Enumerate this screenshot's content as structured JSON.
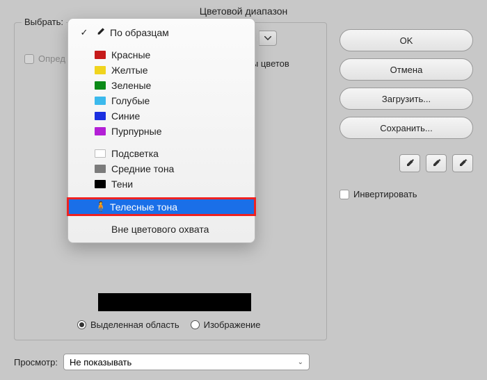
{
  "dialog": {
    "title": "Цветовой диапазон",
    "select_label": "Выбрать:",
    "detect_label": "Опред",
    "partial_text": "боры цветов"
  },
  "dropdown": {
    "sampled": "По образцам",
    "colors": [
      {
        "label": "Красные",
        "color": "#c61a1a"
      },
      {
        "label": "Желтые",
        "color": "#f0d41e"
      },
      {
        "label": "Зеленые",
        "color": "#0a8a17"
      },
      {
        "label": "Голубые",
        "color": "#3bb9ec"
      },
      {
        "label": "Синие",
        "color": "#1a2fe0"
      },
      {
        "label": "Пурпурные",
        "color": "#b31fd6"
      }
    ],
    "tones": [
      {
        "label": "Подсветка",
        "swatch": "#ffffff",
        "border": "#bbb"
      },
      {
        "label": "Средние тона",
        "swatch": "#7b7b7b"
      },
      {
        "label": "Тени",
        "swatch": "#000000"
      }
    ],
    "skin": "Телесные тона",
    "out_of_gamut": "Вне цветового охвата"
  },
  "radios": {
    "selection": "Выделенная область",
    "image": "Изображение"
  },
  "buttons": {
    "ok": "OK",
    "cancel": "Отмена",
    "load": "Загрузить...",
    "save": "Сохранить..."
  },
  "invert": "Инвертировать",
  "bottom": {
    "label": "Просмотр:",
    "value": "Не показывать"
  }
}
